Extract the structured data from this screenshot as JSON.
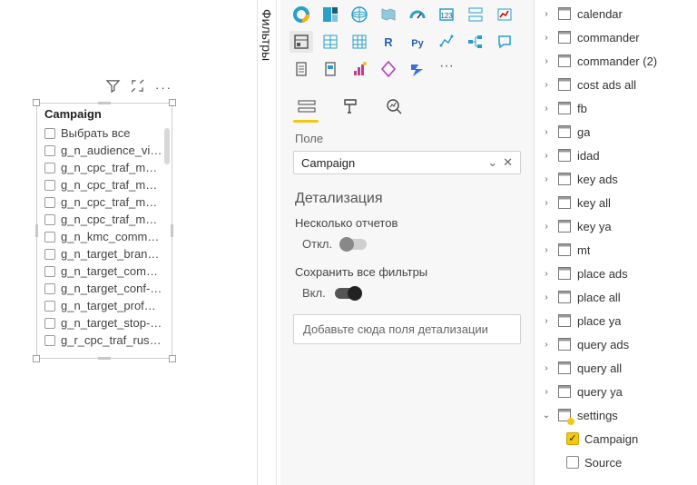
{
  "filters_label": "Фильтры",
  "slicer": {
    "title": "Campaign",
    "items": [
      "Выбрать все",
      "g_n_audience_visit...",
      "g_n_cpc_traf_msk_...",
      "g_n_cpc_traf_msk_...",
      "g_n_cpc_traf_msk_...",
      "g_n_cpc_traf_msk_l...",
      "g_n_kmc_common_...",
      "g_n_target_brand_r...",
      "g_n_target_compet...",
      "g_n_target_conf-sc...",
      "g_n_target_prof_rus",
      "g_n_target_stop-b...",
      "g_r_cpc_traf_rus_re..."
    ]
  },
  "pane": {
    "field_label": "Поле",
    "field_value": "Campaign",
    "detail_header": "Детализация",
    "multi_label": "Несколько отчетов",
    "off_label": "Откл.",
    "keep_label": "Сохранить все фильтры",
    "on_label": "Вкл.",
    "drop_hint": "Добавьте сюда поля детализации"
  },
  "tables": [
    {
      "name": "calendar",
      "expanded": false,
      "marked": false
    },
    {
      "name": "commander",
      "expanded": false,
      "marked": false
    },
    {
      "name": "commander (2)",
      "expanded": false,
      "marked": false
    },
    {
      "name": "cost ads all",
      "expanded": false,
      "marked": false
    },
    {
      "name": "fb",
      "expanded": false,
      "marked": false
    },
    {
      "name": "ga",
      "expanded": false,
      "marked": false
    },
    {
      "name": "idad",
      "expanded": false,
      "marked": false
    },
    {
      "name": "key ads",
      "expanded": false,
      "marked": false
    },
    {
      "name": "key all",
      "expanded": false,
      "marked": false
    },
    {
      "name": "key ya",
      "expanded": false,
      "marked": false
    },
    {
      "name": "mt",
      "expanded": false,
      "marked": false
    },
    {
      "name": "place ads",
      "expanded": false,
      "marked": false
    },
    {
      "name": "place all",
      "expanded": false,
      "marked": false
    },
    {
      "name": "place ya",
      "expanded": false,
      "marked": false
    },
    {
      "name": "query ads",
      "expanded": false,
      "marked": false
    },
    {
      "name": "query all",
      "expanded": false,
      "marked": false
    },
    {
      "name": "query ya",
      "expanded": false,
      "marked": false
    },
    {
      "name": "settings",
      "expanded": true,
      "marked": true
    }
  ],
  "settings_fields": [
    {
      "name": "Campaign",
      "checked": true
    },
    {
      "name": "Source",
      "checked": false
    }
  ]
}
